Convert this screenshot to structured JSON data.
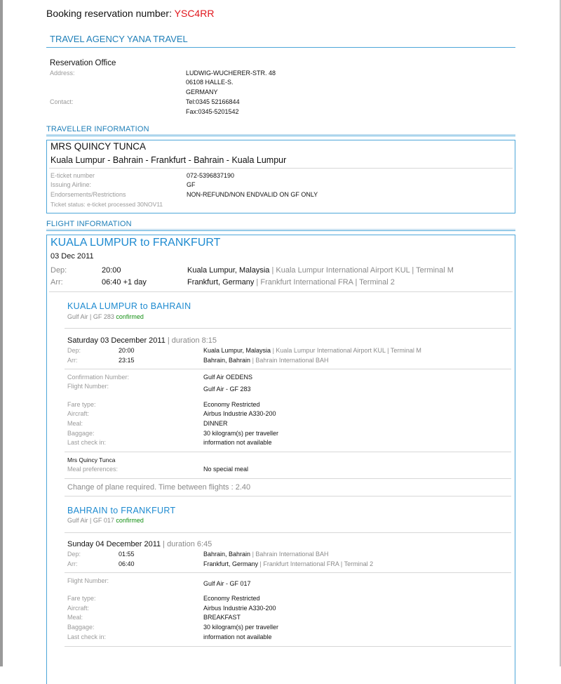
{
  "booking": {
    "label": "Booking reservation number:",
    "number": "YSC4RR"
  },
  "agency": {
    "title": "TRAVEL AGENCY YANA TRAVEL",
    "office": "Reservation Office",
    "address_label": "Address:",
    "address_lines": [
      "LUDWIG-WUCHERER-STR. 48",
      "06108 HALLE-S.",
      "GERMANY"
    ],
    "contact_label": "Contact:",
    "contact_lines": [
      "Tel:0345 52166844",
      "Fax:0345-5201542"
    ]
  },
  "traveller": {
    "section_title": "TRAVELLER INFORMATION",
    "name": "MRS QUINCY TUNCA",
    "route": "Kuala Lumpur - Bahrain - Frankfurt - Bahrain - Kuala Lumpur",
    "eticket_label": "E-ticket number",
    "eticket_value": "072-5396837190",
    "airline_label": "Issuing Airline:",
    "airline_value": "GF",
    "endorse_label": "Endorsements/Restrictions",
    "endorse_value": "NON-REFUND/NON ENDVALID ON GF ONLY",
    "status_text": "Ticket status: e-ticket processed 30NOV11"
  },
  "flight": {
    "section_title": "FLIGHT INFORMATION",
    "title": "KUALA LUMPUR to FRANKFURT",
    "date": "03 Dec 2011",
    "dep_label": "Dep:",
    "dep_time": "20:00",
    "dep_city": "Kuala Lumpur, Malaysia",
    "dep_sep": "|",
    "dep_detail": "Kuala Lumpur International Airport KUL | Terminal M",
    "arr_label": "Arr:",
    "arr_time": "06:40 +1 day",
    "arr_city": "Frankfurt, Germany",
    "arr_sep": "|",
    "arr_detail": "Frankfurt International FRA | Terminal 2",
    "segments": [
      {
        "title": "KUALA LUMPUR to BAHRAIN",
        "carrier": "Gulf Air | GF 283",
        "status": "confirmed",
        "date": "Saturday 03 December 2011",
        "duration": "| duration 8:15",
        "dep_label": "Dep:",
        "dep_time": "20:00",
        "dep_city": "Kuala Lumpur, Malaysia",
        "dep_detail": "| Kuala Lumpur International Airport KUL | Terminal M",
        "arr_label": "Arr:",
        "arr_time": "23:15",
        "arr_city": "Bahrain, Bahrain",
        "arr_detail": "| Bahrain International BAH",
        "conf_label": "Confirmation Number:",
        "conf_value": "Gulf Air OEDENS",
        "flightno_label": "Flight Number:",
        "flightno_value": "Gulf Air - GF 283",
        "fare_label": "Fare type:",
        "fare_value": "Economy Restricted",
        "aircraft_label": "Aircraft:",
        "aircraft_value": "Airbus Industrie A330-200",
        "meal_label": "Meal:",
        "meal_value": "DINNER",
        "baggage_label": "Baggage:",
        "baggage_value": "30 kilogram(s) per traveller",
        "checkin_label": "Last check in:",
        "checkin_value": "information not available",
        "pax_name": "Mrs Quincy Tunca",
        "mealpref_label": "Meal preferences:",
        "mealpref_value": "No special meal",
        "change_note": "Change of plane required. Time between flights : 2.40"
      },
      {
        "title": "BAHRAIN to FRANKFURT",
        "carrier": "Gulf Air | GF 017",
        "status": "confirmed",
        "date": "Sunday 04 December 2011",
        "duration": "| duration 6:45",
        "dep_label": "Dep:",
        "dep_time": "01:55",
        "dep_city": "Bahrain, Bahrain",
        "dep_detail": "| Bahrain International BAH",
        "arr_label": "Arr:",
        "arr_time": "06:40",
        "arr_city": "Frankfurt, Germany",
        "arr_detail": "| Frankfurt International FRA | Terminal 2",
        "flightno_label": "Flight Number:",
        "flightno_value": "Gulf Air - GF 017",
        "fare_label": "Fare type:",
        "fare_value": "Economy Restricted",
        "aircraft_label": "Aircraft:",
        "aircraft_value": "Airbus Industrie A330-200",
        "meal_label": "Meal:",
        "meal_value": "BREAKFAST",
        "baggage_label": "Baggage:",
        "baggage_value": "30 kilogram(s) per traveller",
        "checkin_label": "Last check in:",
        "checkin_value": "information not available"
      }
    ]
  }
}
